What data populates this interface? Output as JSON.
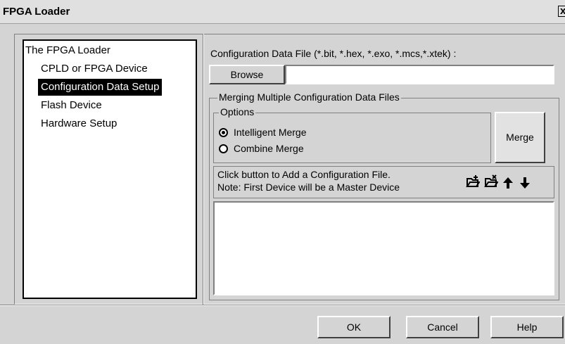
{
  "window": {
    "title": "FPGA Loader",
    "close_label": "x"
  },
  "tree": {
    "items": [
      {
        "label": "The FPGA Loader",
        "selected": false
      },
      {
        "label": "CPLD or FPGA Device",
        "selected": false
      },
      {
        "label": "Configuration Data Setup",
        "selected": true
      },
      {
        "label": "Flash Device",
        "selected": false
      },
      {
        "label": "Hardware Setup",
        "selected": false
      }
    ]
  },
  "config": {
    "file_label": "Configuration Data File (*.bit, *.hex, *.exo, *.mcs,*.xtek) :",
    "browse_label": "Browse",
    "file_value": ""
  },
  "merging": {
    "group_title": "Merging Multiple Configuration Data Files",
    "options_title": "Options",
    "option_intelligent": "Intelligent Merge",
    "option_combine": "Combine Merge",
    "selected_option": "Intelligent Merge",
    "merge_label": "Merge",
    "hint_line1": "Click button to Add a Configuration File.",
    "hint_line2": "Note: First Device will be a Master Device",
    "icons": [
      "add-file-icon",
      "remove-file-icon",
      "move-up-icon",
      "move-down-icon"
    ]
  },
  "footer": {
    "ok_label": "OK",
    "cancel_label": "Cancel",
    "help_label": "Help"
  }
}
